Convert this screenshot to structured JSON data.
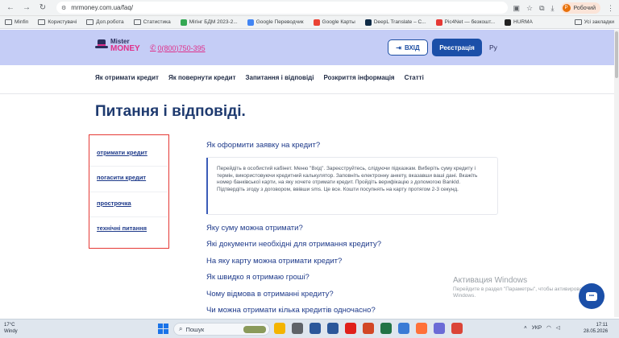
{
  "browser": {
    "url": "mrmoney.com.ua/faq/",
    "profile_label": "Робочий",
    "profile_initial": "P",
    "all_bookmarks": "Усі закладки",
    "bookmarks": [
      {
        "label": "Minfin",
        "kind": "folder"
      },
      {
        "label": "Користувачі",
        "kind": "folder"
      },
      {
        "label": "Доп.робота",
        "kind": "folder"
      },
      {
        "label": "Статистика",
        "kind": "folder"
      },
      {
        "label": "Мігінг БДМ 2023-2...",
        "kind": "fav",
        "color": "#34a853"
      },
      {
        "label": "Google Переводчик",
        "kind": "fav",
        "color": "#4285f4"
      },
      {
        "label": "Google Карты",
        "kind": "fav",
        "color": "#ea4335"
      },
      {
        "label": "DeepL Translate – С...",
        "kind": "fav",
        "color": "#0f2b46"
      },
      {
        "label": "Pic4Net — безкошт...",
        "kind": "fav",
        "color": "#e53935"
      },
      {
        "label": "HURMA",
        "kind": "fav",
        "color": "#222222"
      }
    ]
  },
  "site": {
    "logo_line1": "Mister",
    "logo_line2": "MONEY",
    "phone": "0(800)750-395",
    "login_label": "ВХІД",
    "register_label": "Реєстрація",
    "lang": "Ру",
    "menu": [
      "Як отримати кредит",
      "Як повернути кредит",
      "Запитання і відповіді",
      "Розкриття інформація",
      "Статті"
    ],
    "page_title": "Питання і відповіді.",
    "categories": [
      "отримати кредит",
      "погасити кредит",
      "прострочка",
      "технічні питання"
    ],
    "faq_open_question": "Як оформити заявку на кредит?",
    "faq_open_answer": "Перейдіть в особистий кабінет. Меню \"Вхід\". Зареєструйтесь, слідуючи підказкам. Виберіть суму кредиту і термін, використовуючи кредитний калькулятор. Заповніть електронну анкету, вказавши ваші дані. Вкажіть номер банківської карти, на яку хочете отримати кредит. Пройдіть верифікацію з допомогою BankId. Підтвердіть згоду з договором, ввівши sms. Це все. Кошти посупнять на карту протягом 2-3 секунд.",
    "faq_questions": [
      "Яку суму можна отримати?",
      "Які документи необхідні для отримання кредиту?",
      "На яку карту можна отримати кредит?",
      "Як швидко я отримаю гроші?",
      "Чому відмова в отриманні кредиту?",
      "Чи можна отримати кілька кредитів одночасно?"
    ]
  },
  "windows": {
    "activate_title": "Активация Windows",
    "activate_text": "Перейдите в раздел \"Параметры\", чтобы активировать Windows.",
    "weather_temp": "17°C",
    "weather_desc": "Windy",
    "search_placeholder": "Пошук",
    "lang": "УКР",
    "time": "17:11",
    "date": "28.05.2026",
    "apps": [
      {
        "name": "file-explorer",
        "color": "#f4b400"
      },
      {
        "name": "task-view",
        "color": "#5f6368"
      },
      {
        "name": "store",
        "color": "#2b579a"
      },
      {
        "name": "word",
        "color": "#2b579a"
      },
      {
        "name": "opera",
        "color": "#e0201b"
      },
      {
        "name": "powerpoint",
        "color": "#d24726"
      },
      {
        "name": "excel",
        "color": "#217346"
      },
      {
        "name": "photos",
        "color": "#3a7bd5"
      },
      {
        "name": "firefox",
        "color": "#ff7139"
      },
      {
        "name": "media",
        "color": "#6b6bd6"
      },
      {
        "name": "chrome",
        "color": "#db4437"
      }
    ]
  }
}
